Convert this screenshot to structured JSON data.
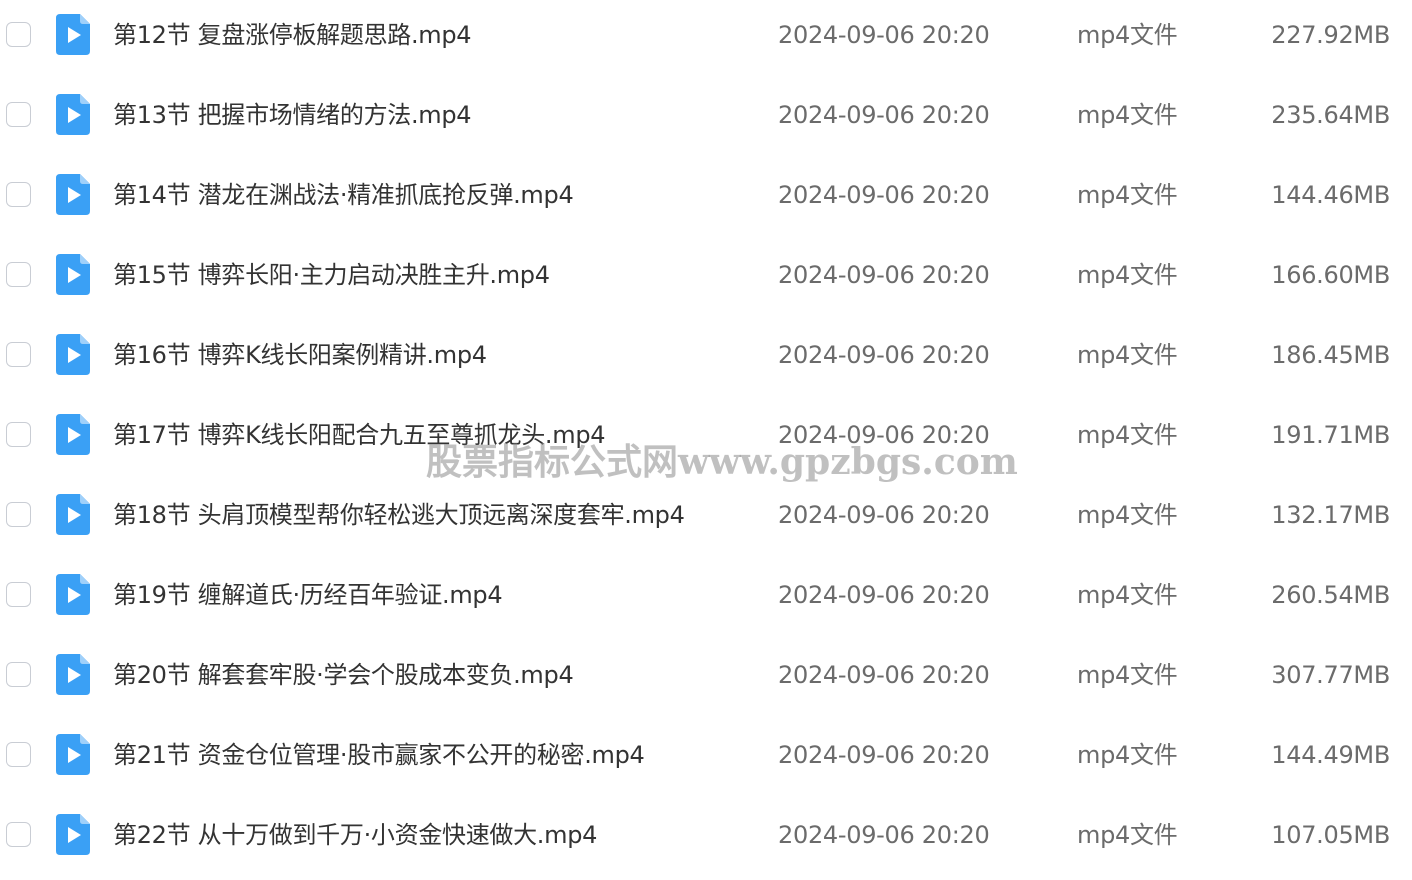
{
  "files": [
    {
      "name": "第12节 复盘涨停板解题思路.mp4",
      "date": "2024-09-06 20:20",
      "type": "mp4文件",
      "size": "227.92MB",
      "icon": "video-file-icon"
    },
    {
      "name": "第13节 把握市场情绪的方法.mp4",
      "date": "2024-09-06 20:20",
      "type": "mp4文件",
      "size": "235.64MB",
      "icon": "video-file-icon"
    },
    {
      "name": "第14节 潜龙在渊战法·精准抓底抢反弹.mp4",
      "date": "2024-09-06 20:20",
      "type": "mp4文件",
      "size": "144.46MB",
      "icon": "video-file-icon"
    },
    {
      "name": "第15节 博弈长阳·主力启动决胜主升.mp4",
      "date": "2024-09-06 20:20",
      "type": "mp4文件",
      "size": "166.60MB",
      "icon": "video-file-icon"
    },
    {
      "name": "第16节 博弈K线长阳案例精讲.mp4",
      "date": "2024-09-06 20:20",
      "type": "mp4文件",
      "size": "186.45MB",
      "icon": "video-file-icon"
    },
    {
      "name": "第17节 博弈K线长阳配合九五至尊抓龙头.mp4",
      "date": "2024-09-06 20:20",
      "type": "mp4文件",
      "size": "191.71MB",
      "icon": "video-file-icon"
    },
    {
      "name": "第18节 头肩顶模型帮你轻松逃大顶远离深度套牢.mp4",
      "date": "2024-09-06 20:20",
      "type": "mp4文件",
      "size": "132.17MB",
      "icon": "video-file-icon"
    },
    {
      "name": "第19节 缠解道氏·历经百年验证.mp4",
      "date": "2024-09-06 20:20",
      "type": "mp4文件",
      "size": "260.54MB",
      "icon": "video-file-icon"
    },
    {
      "name": "第20节 解套套牢股·学会个股成本变负.mp4",
      "date": "2024-09-06 20:20",
      "type": "mp4文件",
      "size": "307.77MB",
      "icon": "video-file-icon"
    },
    {
      "name": "第21节 资金仓位管理·股市赢家不公开的秘密.mp4",
      "date": "2024-09-06 20:20",
      "type": "mp4文件",
      "size": "144.49MB",
      "icon": "video-file-icon"
    },
    {
      "name": "第22节 从十万做到千万·小资金快速做大.mp4",
      "date": "2024-09-06 20:20",
      "type": "mp4文件",
      "size": "107.05MB",
      "icon": "video-file-icon"
    }
  ],
  "watermark": "股票指标公式网www.gpzbgs.com",
  "colors": {
    "icon_blue": "#3aa0f5",
    "icon_fold": "#9fd0fa",
    "name_text": "#333333",
    "meta_text": "#6b6b6b",
    "checkbox_border": "#c9cdd4"
  }
}
